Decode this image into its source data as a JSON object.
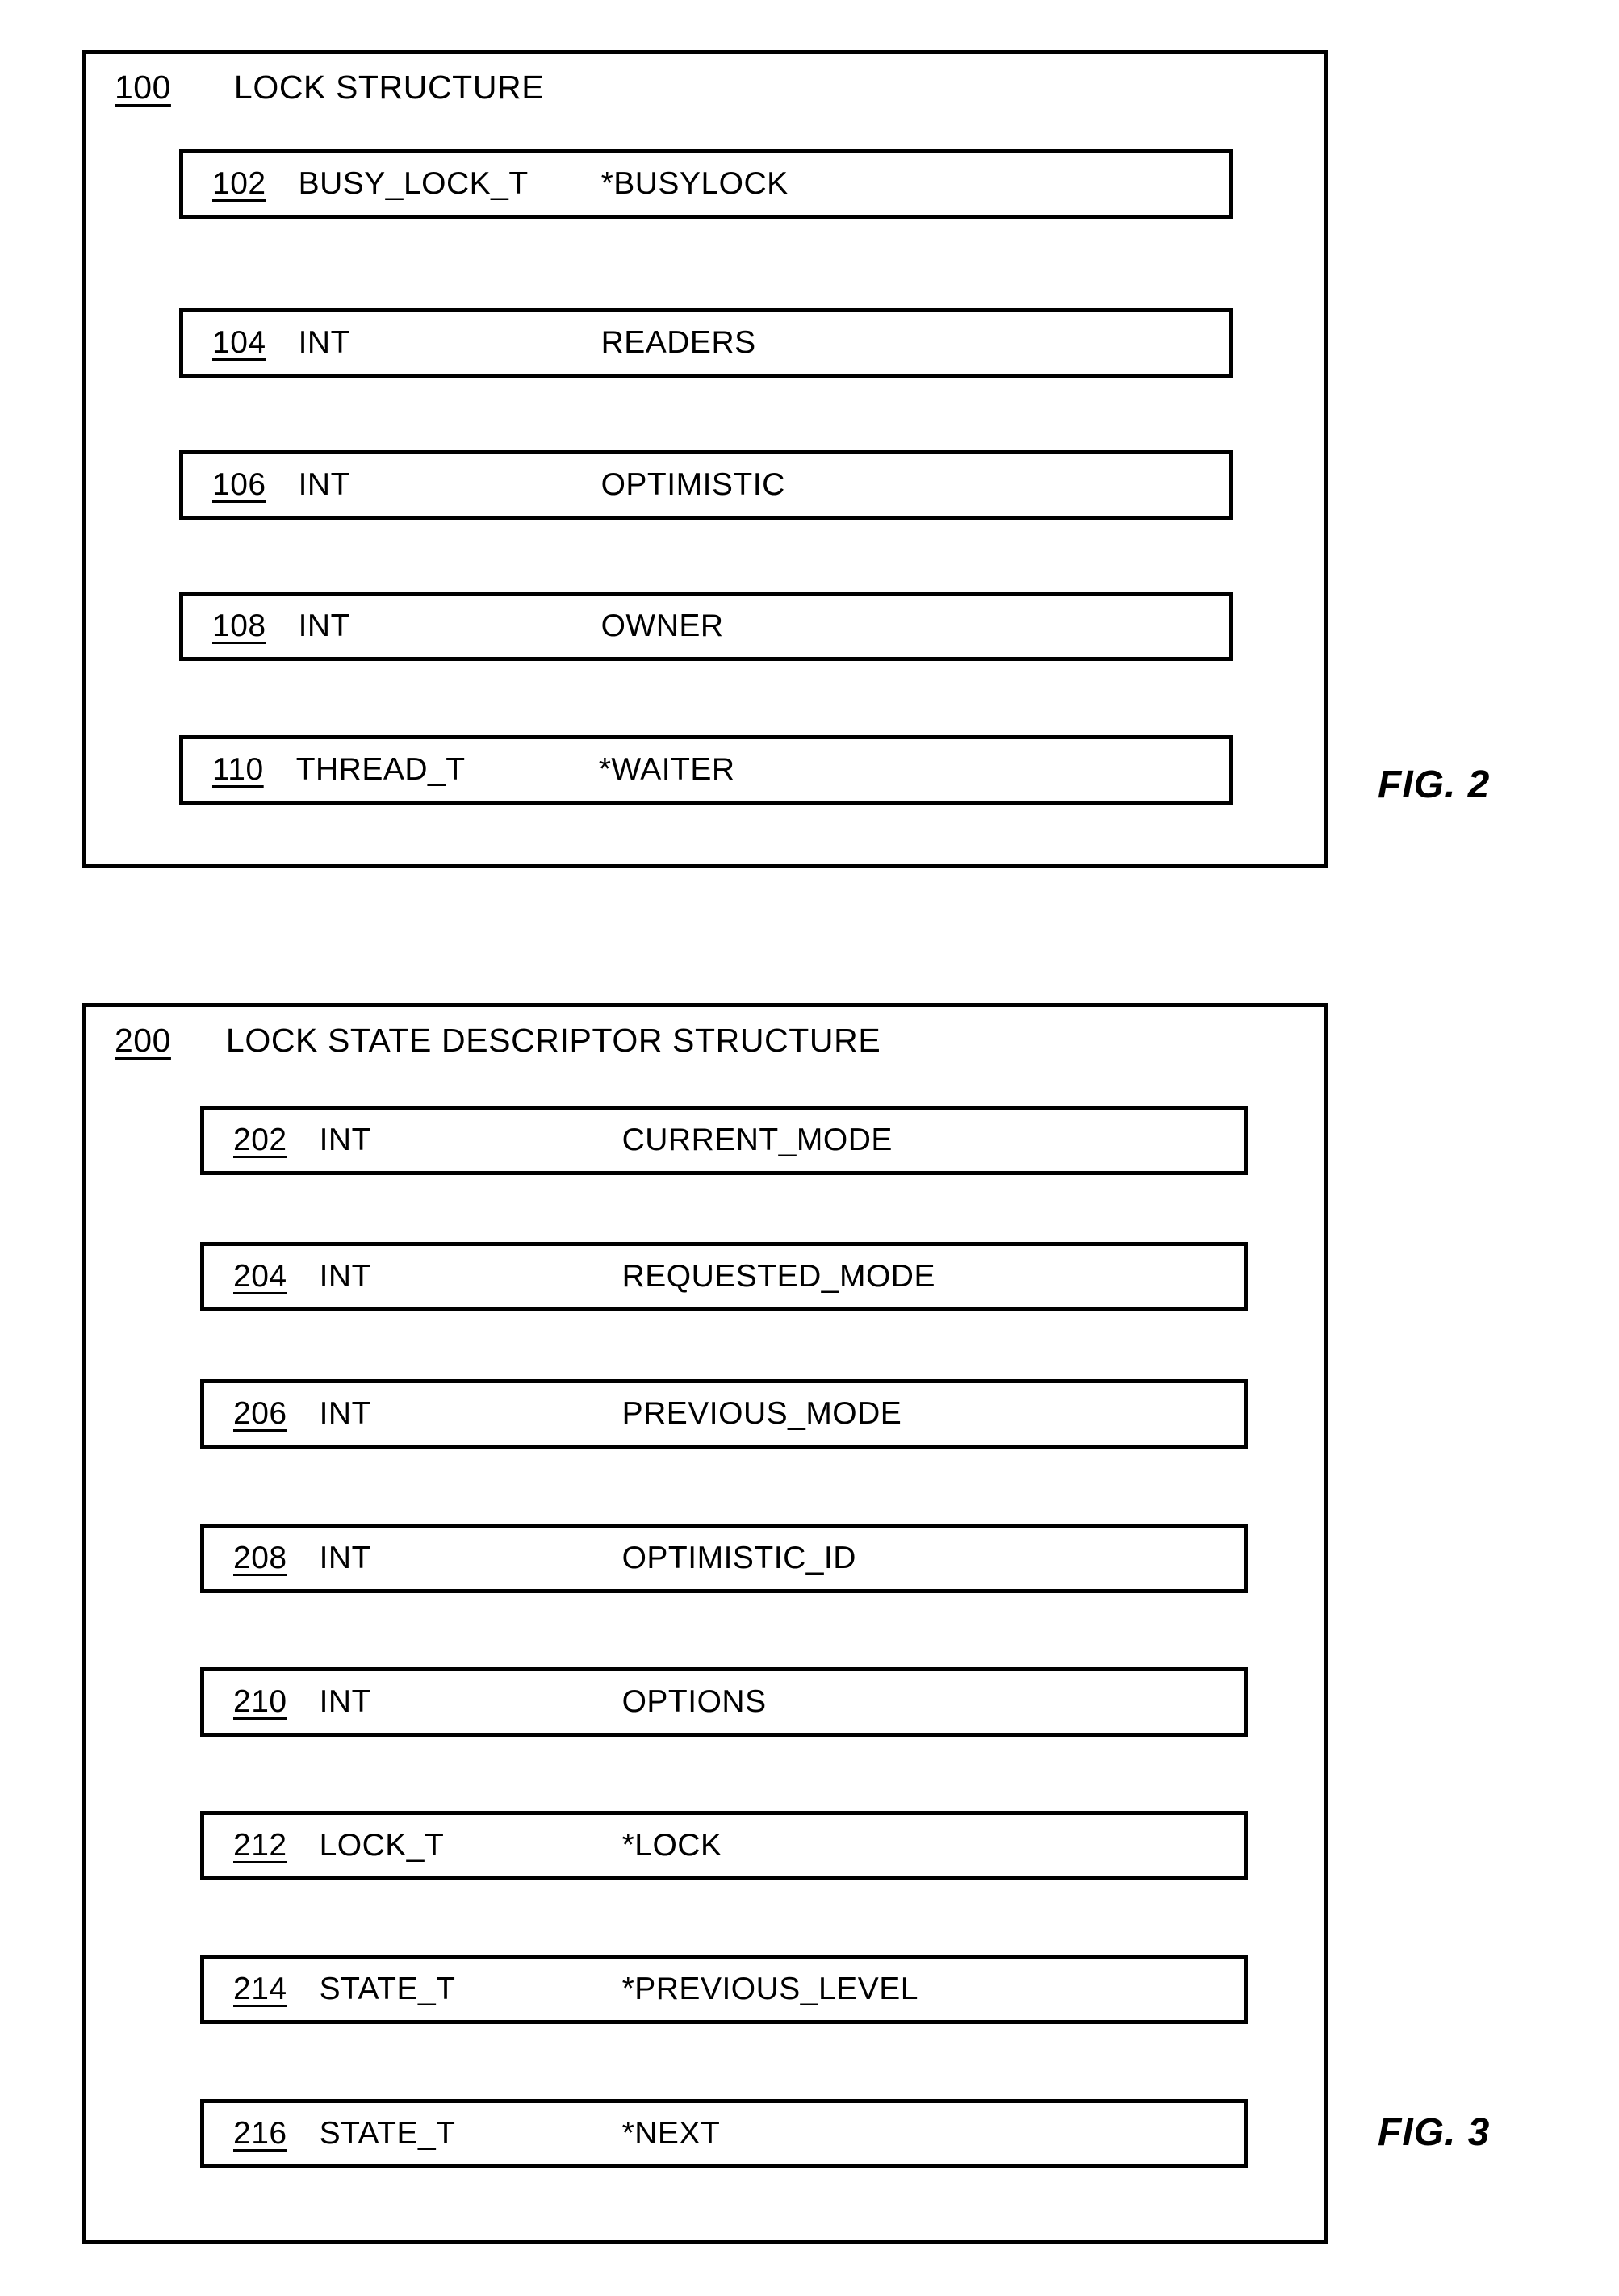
{
  "figures": [
    {
      "caption": "FIG. 2",
      "structure": {
        "ref": "100",
        "title": "LOCK STRUCTURE"
      },
      "fields": [
        {
          "ref": "102",
          "type": "BUSY_LOCK_T",
          "name": "*BUSYLOCK"
        },
        {
          "ref": "104",
          "type": "INT",
          "name": "READERS"
        },
        {
          "ref": "106",
          "type": "INT",
          "name": "OPTIMISTIC"
        },
        {
          "ref": "108",
          "type": "INT",
          "name": "OWNER"
        },
        {
          "ref": "110",
          "type": "THREAD_T",
          "name": "*WAITER"
        }
      ]
    },
    {
      "caption": "FIG. 3",
      "structure": {
        "ref": "200",
        "title": "LOCK STATE DESCRIPTOR STRUCTURE"
      },
      "fields": [
        {
          "ref": "202",
          "type": "INT",
          "name": "CURRENT_MODE"
        },
        {
          "ref": "204",
          "type": "INT",
          "name": "REQUESTED_MODE"
        },
        {
          "ref": "206",
          "type": "INT",
          "name": "PREVIOUS_MODE"
        },
        {
          "ref": "208",
          "type": "INT",
          "name": "OPTIMISTIC_ID"
        },
        {
          "ref": "210",
          "type": "INT",
          "name": "OPTIONS"
        },
        {
          "ref": "212",
          "type": "LOCK_T",
          "name": "*LOCK"
        },
        {
          "ref": "214",
          "type": "STATE_T",
          "name": "*PREVIOUS_LEVEL"
        },
        {
          "ref": "216",
          "type": "STATE_T",
          "name": "*NEXT"
        }
      ]
    }
  ],
  "colors": {
    "ink": "#000000",
    "paper": "#ffffff"
  }
}
